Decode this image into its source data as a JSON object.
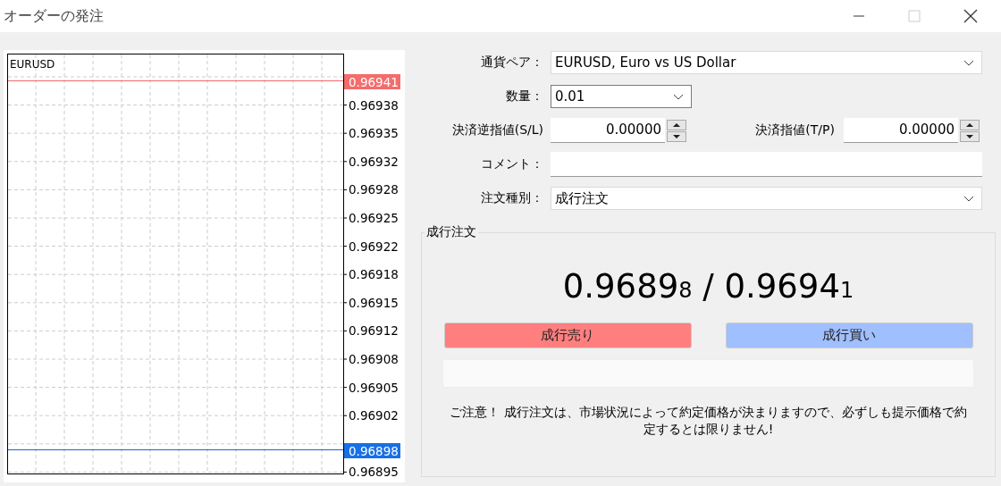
{
  "window": {
    "title": "オーダーの発注"
  },
  "chart": {
    "symbol": "EURUSD",
    "price_labels": [
      "0.96938",
      "0.96935",
      "0.96932",
      "0.96928",
      "0.96925",
      "0.96922",
      "0.96918",
      "0.96915",
      "0.96912",
      "0.96908",
      "0.96905",
      "0.96902",
      "0.96895"
    ],
    "ask": "0.96941",
    "bid": "0.96898"
  },
  "form": {
    "symbol": {
      "label": "通貨ペア：",
      "value": "EURUSD, Euro vs US Dollar"
    },
    "volume": {
      "label": "数量：",
      "value": "0.01"
    },
    "stop_loss": {
      "label": "決済逆指値(S/L)",
      "value": "0.00000"
    },
    "take_profit": {
      "label": "決済指値(T/P)",
      "value": "0.00000"
    },
    "comment": {
      "label": "コメント："
    },
    "order_type": {
      "label": "注文種別：",
      "value": "成行注文"
    }
  },
  "market": {
    "title": "成行注文",
    "quote": "0.9689$_{8}$ / 0.9694$_{1}$",
    "sell": "成行売り",
    "buy": "成行買い",
    "notice": "ご注意！ 成行注文は、市場状況によって約定価格が決まりますので、必ずしも提示価格で約定するとは限りません!"
  }
}
